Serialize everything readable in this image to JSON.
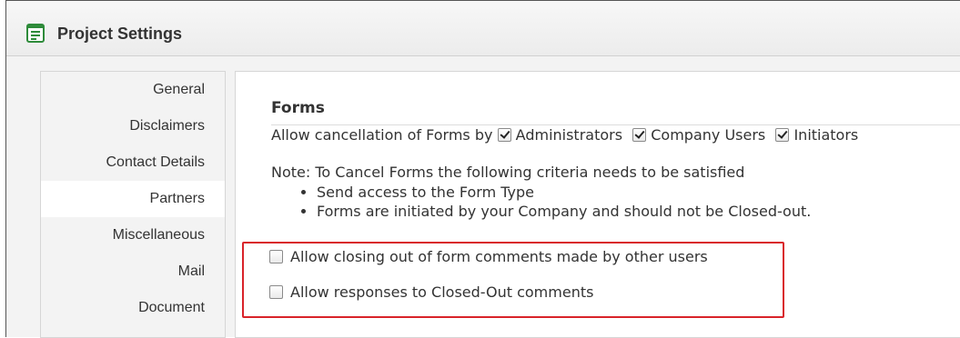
{
  "window": {
    "title": "Project Settings",
    "icon": "form-document-icon",
    "icon_color": "#2e8b3a"
  },
  "sidebar": {
    "items": [
      {
        "label": "General",
        "active": false
      },
      {
        "label": "Disclaimers",
        "active": false
      },
      {
        "label": "Contact Details",
        "active": false
      },
      {
        "label": "Partners",
        "active": true
      },
      {
        "label": "Miscellaneous",
        "active": false
      },
      {
        "label": "Mail",
        "active": false
      },
      {
        "label": "Document",
        "active": false
      }
    ]
  },
  "forms": {
    "heading": "Forms",
    "cancel_label": "Allow cancellation of Forms by",
    "cancel_options": [
      {
        "label": "Administrators",
        "checked": true
      },
      {
        "label": "Company Users",
        "checked": true
      },
      {
        "label": "Initiators",
        "checked": true
      }
    ],
    "note": "Note: To Cancel Forms the following criteria needs to be satisfied",
    "criteria": [
      "Send access to the Form Type",
      "Forms are initiated by your Company and should not be Closed-out."
    ],
    "options": [
      {
        "label": "Allow closing out of form comments made by other users",
        "checked": false
      },
      {
        "label": "Allow responses to Closed-Out comments",
        "checked": false
      }
    ]
  },
  "colors": {
    "highlight_border": "#d9232a",
    "panel_background": "#f3f3f3"
  }
}
